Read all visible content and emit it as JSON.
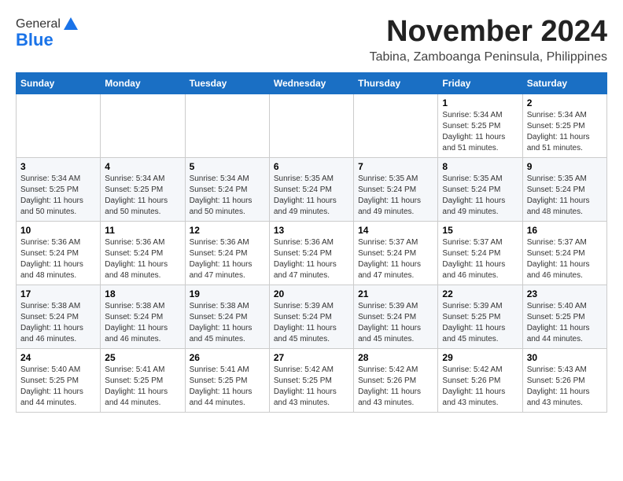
{
  "header": {
    "logo_general": "General",
    "logo_blue": "Blue",
    "month_title": "November 2024",
    "location": "Tabina, Zamboanga Peninsula, Philippines"
  },
  "weekdays": [
    "Sunday",
    "Monday",
    "Tuesday",
    "Wednesday",
    "Thursday",
    "Friday",
    "Saturday"
  ],
  "weeks": [
    [
      {
        "day": "",
        "info": ""
      },
      {
        "day": "",
        "info": ""
      },
      {
        "day": "",
        "info": ""
      },
      {
        "day": "",
        "info": ""
      },
      {
        "day": "",
        "info": ""
      },
      {
        "day": "1",
        "info": "Sunrise: 5:34 AM\nSunset: 5:25 PM\nDaylight: 11 hours\nand 51 minutes."
      },
      {
        "day": "2",
        "info": "Sunrise: 5:34 AM\nSunset: 5:25 PM\nDaylight: 11 hours\nand 51 minutes."
      }
    ],
    [
      {
        "day": "3",
        "info": "Sunrise: 5:34 AM\nSunset: 5:25 PM\nDaylight: 11 hours\nand 50 minutes."
      },
      {
        "day": "4",
        "info": "Sunrise: 5:34 AM\nSunset: 5:25 PM\nDaylight: 11 hours\nand 50 minutes."
      },
      {
        "day": "5",
        "info": "Sunrise: 5:34 AM\nSunset: 5:24 PM\nDaylight: 11 hours\nand 50 minutes."
      },
      {
        "day": "6",
        "info": "Sunrise: 5:35 AM\nSunset: 5:24 PM\nDaylight: 11 hours\nand 49 minutes."
      },
      {
        "day": "7",
        "info": "Sunrise: 5:35 AM\nSunset: 5:24 PM\nDaylight: 11 hours\nand 49 minutes."
      },
      {
        "day": "8",
        "info": "Sunrise: 5:35 AM\nSunset: 5:24 PM\nDaylight: 11 hours\nand 49 minutes."
      },
      {
        "day": "9",
        "info": "Sunrise: 5:35 AM\nSunset: 5:24 PM\nDaylight: 11 hours\nand 48 minutes."
      }
    ],
    [
      {
        "day": "10",
        "info": "Sunrise: 5:36 AM\nSunset: 5:24 PM\nDaylight: 11 hours\nand 48 minutes."
      },
      {
        "day": "11",
        "info": "Sunrise: 5:36 AM\nSunset: 5:24 PM\nDaylight: 11 hours\nand 48 minutes."
      },
      {
        "day": "12",
        "info": "Sunrise: 5:36 AM\nSunset: 5:24 PM\nDaylight: 11 hours\nand 47 minutes."
      },
      {
        "day": "13",
        "info": "Sunrise: 5:36 AM\nSunset: 5:24 PM\nDaylight: 11 hours\nand 47 minutes."
      },
      {
        "day": "14",
        "info": "Sunrise: 5:37 AM\nSunset: 5:24 PM\nDaylight: 11 hours\nand 47 minutes."
      },
      {
        "day": "15",
        "info": "Sunrise: 5:37 AM\nSunset: 5:24 PM\nDaylight: 11 hours\nand 46 minutes."
      },
      {
        "day": "16",
        "info": "Sunrise: 5:37 AM\nSunset: 5:24 PM\nDaylight: 11 hours\nand 46 minutes."
      }
    ],
    [
      {
        "day": "17",
        "info": "Sunrise: 5:38 AM\nSunset: 5:24 PM\nDaylight: 11 hours\nand 46 minutes."
      },
      {
        "day": "18",
        "info": "Sunrise: 5:38 AM\nSunset: 5:24 PM\nDaylight: 11 hours\nand 46 minutes."
      },
      {
        "day": "19",
        "info": "Sunrise: 5:38 AM\nSunset: 5:24 PM\nDaylight: 11 hours\nand 45 minutes."
      },
      {
        "day": "20",
        "info": "Sunrise: 5:39 AM\nSunset: 5:24 PM\nDaylight: 11 hours\nand 45 minutes."
      },
      {
        "day": "21",
        "info": "Sunrise: 5:39 AM\nSunset: 5:24 PM\nDaylight: 11 hours\nand 45 minutes."
      },
      {
        "day": "22",
        "info": "Sunrise: 5:39 AM\nSunset: 5:25 PM\nDaylight: 11 hours\nand 45 minutes."
      },
      {
        "day": "23",
        "info": "Sunrise: 5:40 AM\nSunset: 5:25 PM\nDaylight: 11 hours\nand 44 minutes."
      }
    ],
    [
      {
        "day": "24",
        "info": "Sunrise: 5:40 AM\nSunset: 5:25 PM\nDaylight: 11 hours\nand 44 minutes."
      },
      {
        "day": "25",
        "info": "Sunrise: 5:41 AM\nSunset: 5:25 PM\nDaylight: 11 hours\nand 44 minutes."
      },
      {
        "day": "26",
        "info": "Sunrise: 5:41 AM\nSunset: 5:25 PM\nDaylight: 11 hours\nand 44 minutes."
      },
      {
        "day": "27",
        "info": "Sunrise: 5:42 AM\nSunset: 5:25 PM\nDaylight: 11 hours\nand 43 minutes."
      },
      {
        "day": "28",
        "info": "Sunrise: 5:42 AM\nSunset: 5:26 PM\nDaylight: 11 hours\nand 43 minutes."
      },
      {
        "day": "29",
        "info": "Sunrise: 5:42 AM\nSunset: 5:26 PM\nDaylight: 11 hours\nand 43 minutes."
      },
      {
        "day": "30",
        "info": "Sunrise: 5:43 AM\nSunset: 5:26 PM\nDaylight: 11 hours\nand 43 minutes."
      }
    ]
  ]
}
